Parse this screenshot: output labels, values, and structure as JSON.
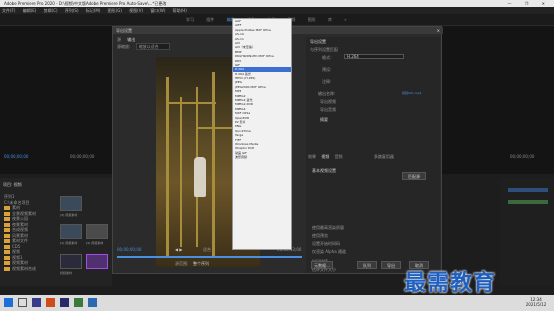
{
  "app": {
    "title": "Adobe Premiere Pro 2020 - D:\\视频\\中文版Adobe Premiere Pro Auto-Save\\...*已更改",
    "window_controls": "— ❐ ✕"
  },
  "menu": [
    "文件(F)",
    "编辑(E)",
    "剪辑(C)",
    "序列(S)",
    "标记(M)",
    "图形(G)",
    "视图(V)",
    "窗口(W)",
    "帮助(H)"
  ],
  "workspaces": [
    "学习",
    "组件",
    "编辑",
    "颜色",
    "效果",
    "音频",
    "图形",
    "库",
    "»"
  ],
  "workspace_active_index": 2,
  "source_monitor": {
    "timecode_left": "00;00;00;00",
    "timecode_right": "00;00;00;00"
  },
  "project_panel": {
    "title": "项目: 视频",
    "items": [
      "序列1",
      "C:\\未命名项目",
      "素材",
      "全景视频素材",
      "夜景公园",
      "夜景素材",
      "合成视频",
      "风景素材",
      "素材文件",
      "CD5",
      "视频",
      "视频1",
      "视频素材",
      "视频素材合成"
    ],
    "thumb_labels": [
      "[4] 视频素材",
      "[4] 视频素材",
      "[4] 视频素材",
      "视频素材"
    ]
  },
  "program_monitor": {
    "timecode": "00;00;00;00"
  },
  "dialog": {
    "title": "导出设置",
    "close": "✕",
    "tabs": [
      "源",
      "输出"
    ],
    "source_scaling_label": "源缩放:",
    "source_scaling_value": "缩放以适合",
    "timecode_in": "00;00;00;00",
    "timecode_out": "00;00;13;00",
    "fit_label": "适合",
    "source_range_label": "源范围:",
    "source_range_value": "整个序列",
    "settings_header": "导出设置",
    "match_sequence": "与序列设置匹配",
    "format_label": "格式:",
    "format_value": "H.264",
    "preset_label": "预设:",
    "comments_label": "注释:",
    "output_name_label": "输出名称:",
    "output_name_value": "视频001.mp4",
    "export_video": "导出视频",
    "export_audio": "导出音频",
    "summary_label": "摘要",
    "tabs_lower": [
      "效果",
      "视频",
      "音频",
      "多路复用器",
      "字幕",
      "发布"
    ],
    "basic_video_label": "基本视频设置",
    "match_source": "匹配源",
    "options": [
      "使用最高渲染质量",
      "使用预览",
      "设置开始时间码",
      "仅渲染 Alpha 通道"
    ],
    "time_interp_label": "时间插值",
    "estimated_size_label": "估计文件大小",
    "metadata_button": "元数据...",
    "queue_button": "队列",
    "export_button": "导出",
    "cancel_button": "取消"
  },
  "format_dropdown": {
    "items": [
      "AAF",
      "AIFF",
      "Apple ProRes MXF OP1a",
      "AS-10",
      "AS-11",
      "AVI",
      "AVI（未压缩）",
      "BMP",
      "DNxHR/DNxHD MXF OP1a",
      "DPX",
      "GIF",
      "H.264",
      "H.264 蓝光",
      "HEVC (H.265)",
      "JPEG",
      "JPEG2000 MXF OP1a",
      "MP3",
      "MPEG2",
      "MPEG2 蓝光",
      "MPEG2-DVD",
      "MPEG4",
      "MXF OP1a",
      "OpenEXR",
      "P2 影片",
      "PNG",
      "QuickTime",
      "Targa",
      "TIFF",
      "Windows Media",
      "Wraptor DCP",
      "动画 GIF",
      "波形音频"
    ],
    "selected_index": 11
  },
  "taskbar": {
    "time": "12:34",
    "date": "2021/5/12"
  },
  "watermark": "最需教育"
}
